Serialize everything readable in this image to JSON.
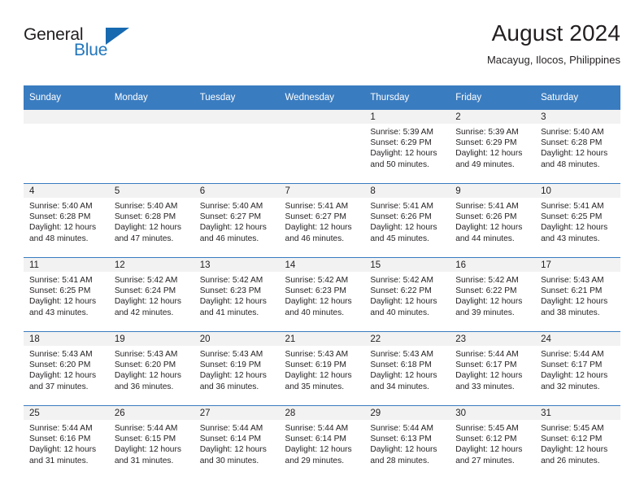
{
  "brand": {
    "name_top": "General",
    "name_bottom": "Blue",
    "accent_color": "#1769b0"
  },
  "header": {
    "title": "August 2024",
    "subtitle": "Macayug, Ilocos, Philippines"
  },
  "theme": {
    "header_row_bg": "#3a7cc0",
    "daynum_band_bg": "#f2f2f2",
    "grid_line": "#3a7cc0",
    "text": "#231f20"
  },
  "weekday_headers": [
    "Sunday",
    "Monday",
    "Tuesday",
    "Wednesday",
    "Thursday",
    "Friday",
    "Saturday"
  ],
  "weeks": [
    [
      {
        "day": "",
        "sunrise": "",
        "sunset": "",
        "daylight_line1": "",
        "daylight_line2": ""
      },
      {
        "day": "",
        "sunrise": "",
        "sunset": "",
        "daylight_line1": "",
        "daylight_line2": ""
      },
      {
        "day": "",
        "sunrise": "",
        "sunset": "",
        "daylight_line1": "",
        "daylight_line2": ""
      },
      {
        "day": "",
        "sunrise": "",
        "sunset": "",
        "daylight_line1": "",
        "daylight_line2": ""
      },
      {
        "day": "1",
        "sunrise": "Sunrise: 5:39 AM",
        "sunset": "Sunset: 6:29 PM",
        "daylight_line1": "Daylight: 12 hours",
        "daylight_line2": "and 50 minutes."
      },
      {
        "day": "2",
        "sunrise": "Sunrise: 5:39 AM",
        "sunset": "Sunset: 6:29 PM",
        "daylight_line1": "Daylight: 12 hours",
        "daylight_line2": "and 49 minutes."
      },
      {
        "day": "3",
        "sunrise": "Sunrise: 5:40 AM",
        "sunset": "Sunset: 6:28 PM",
        "daylight_line1": "Daylight: 12 hours",
        "daylight_line2": "and 48 minutes."
      }
    ],
    [
      {
        "day": "4",
        "sunrise": "Sunrise: 5:40 AM",
        "sunset": "Sunset: 6:28 PM",
        "daylight_line1": "Daylight: 12 hours",
        "daylight_line2": "and 48 minutes."
      },
      {
        "day": "5",
        "sunrise": "Sunrise: 5:40 AM",
        "sunset": "Sunset: 6:28 PM",
        "daylight_line1": "Daylight: 12 hours",
        "daylight_line2": "and 47 minutes."
      },
      {
        "day": "6",
        "sunrise": "Sunrise: 5:40 AM",
        "sunset": "Sunset: 6:27 PM",
        "daylight_line1": "Daylight: 12 hours",
        "daylight_line2": "and 46 minutes."
      },
      {
        "day": "7",
        "sunrise": "Sunrise: 5:41 AM",
        "sunset": "Sunset: 6:27 PM",
        "daylight_line1": "Daylight: 12 hours",
        "daylight_line2": "and 46 minutes."
      },
      {
        "day": "8",
        "sunrise": "Sunrise: 5:41 AM",
        "sunset": "Sunset: 6:26 PM",
        "daylight_line1": "Daylight: 12 hours",
        "daylight_line2": "and 45 minutes."
      },
      {
        "day": "9",
        "sunrise": "Sunrise: 5:41 AM",
        "sunset": "Sunset: 6:26 PM",
        "daylight_line1": "Daylight: 12 hours",
        "daylight_line2": "and 44 minutes."
      },
      {
        "day": "10",
        "sunrise": "Sunrise: 5:41 AM",
        "sunset": "Sunset: 6:25 PM",
        "daylight_line1": "Daylight: 12 hours",
        "daylight_line2": "and 43 minutes."
      }
    ],
    [
      {
        "day": "11",
        "sunrise": "Sunrise: 5:41 AM",
        "sunset": "Sunset: 6:25 PM",
        "daylight_line1": "Daylight: 12 hours",
        "daylight_line2": "and 43 minutes."
      },
      {
        "day": "12",
        "sunrise": "Sunrise: 5:42 AM",
        "sunset": "Sunset: 6:24 PM",
        "daylight_line1": "Daylight: 12 hours",
        "daylight_line2": "and 42 minutes."
      },
      {
        "day": "13",
        "sunrise": "Sunrise: 5:42 AM",
        "sunset": "Sunset: 6:23 PM",
        "daylight_line1": "Daylight: 12 hours",
        "daylight_line2": "and 41 minutes."
      },
      {
        "day": "14",
        "sunrise": "Sunrise: 5:42 AM",
        "sunset": "Sunset: 6:23 PM",
        "daylight_line1": "Daylight: 12 hours",
        "daylight_line2": "and 40 minutes."
      },
      {
        "day": "15",
        "sunrise": "Sunrise: 5:42 AM",
        "sunset": "Sunset: 6:22 PM",
        "daylight_line1": "Daylight: 12 hours",
        "daylight_line2": "and 40 minutes."
      },
      {
        "day": "16",
        "sunrise": "Sunrise: 5:42 AM",
        "sunset": "Sunset: 6:22 PM",
        "daylight_line1": "Daylight: 12 hours",
        "daylight_line2": "and 39 minutes."
      },
      {
        "day": "17",
        "sunrise": "Sunrise: 5:43 AM",
        "sunset": "Sunset: 6:21 PM",
        "daylight_line1": "Daylight: 12 hours",
        "daylight_line2": "and 38 minutes."
      }
    ],
    [
      {
        "day": "18",
        "sunrise": "Sunrise: 5:43 AM",
        "sunset": "Sunset: 6:20 PM",
        "daylight_line1": "Daylight: 12 hours",
        "daylight_line2": "and 37 minutes."
      },
      {
        "day": "19",
        "sunrise": "Sunrise: 5:43 AM",
        "sunset": "Sunset: 6:20 PM",
        "daylight_line1": "Daylight: 12 hours",
        "daylight_line2": "and 36 minutes."
      },
      {
        "day": "20",
        "sunrise": "Sunrise: 5:43 AM",
        "sunset": "Sunset: 6:19 PM",
        "daylight_line1": "Daylight: 12 hours",
        "daylight_line2": "and 36 minutes."
      },
      {
        "day": "21",
        "sunrise": "Sunrise: 5:43 AM",
        "sunset": "Sunset: 6:19 PM",
        "daylight_line1": "Daylight: 12 hours",
        "daylight_line2": "and 35 minutes."
      },
      {
        "day": "22",
        "sunrise": "Sunrise: 5:43 AM",
        "sunset": "Sunset: 6:18 PM",
        "daylight_line1": "Daylight: 12 hours",
        "daylight_line2": "and 34 minutes."
      },
      {
        "day": "23",
        "sunrise": "Sunrise: 5:44 AM",
        "sunset": "Sunset: 6:17 PM",
        "daylight_line1": "Daylight: 12 hours",
        "daylight_line2": "and 33 minutes."
      },
      {
        "day": "24",
        "sunrise": "Sunrise: 5:44 AM",
        "sunset": "Sunset: 6:17 PM",
        "daylight_line1": "Daylight: 12 hours",
        "daylight_line2": "and 32 minutes."
      }
    ],
    [
      {
        "day": "25",
        "sunrise": "Sunrise: 5:44 AM",
        "sunset": "Sunset: 6:16 PM",
        "daylight_line1": "Daylight: 12 hours",
        "daylight_line2": "and 31 minutes."
      },
      {
        "day": "26",
        "sunrise": "Sunrise: 5:44 AM",
        "sunset": "Sunset: 6:15 PM",
        "daylight_line1": "Daylight: 12 hours",
        "daylight_line2": "and 31 minutes."
      },
      {
        "day": "27",
        "sunrise": "Sunrise: 5:44 AM",
        "sunset": "Sunset: 6:14 PM",
        "daylight_line1": "Daylight: 12 hours",
        "daylight_line2": "and 30 minutes."
      },
      {
        "day": "28",
        "sunrise": "Sunrise: 5:44 AM",
        "sunset": "Sunset: 6:14 PM",
        "daylight_line1": "Daylight: 12 hours",
        "daylight_line2": "and 29 minutes."
      },
      {
        "day": "29",
        "sunrise": "Sunrise: 5:44 AM",
        "sunset": "Sunset: 6:13 PM",
        "daylight_line1": "Daylight: 12 hours",
        "daylight_line2": "and 28 minutes."
      },
      {
        "day": "30",
        "sunrise": "Sunrise: 5:45 AM",
        "sunset": "Sunset: 6:12 PM",
        "daylight_line1": "Daylight: 12 hours",
        "daylight_line2": "and 27 minutes."
      },
      {
        "day": "31",
        "sunrise": "Sunrise: 5:45 AM",
        "sunset": "Sunset: 6:12 PM",
        "daylight_line1": "Daylight: 12 hours",
        "daylight_line2": "and 26 minutes."
      }
    ]
  ]
}
